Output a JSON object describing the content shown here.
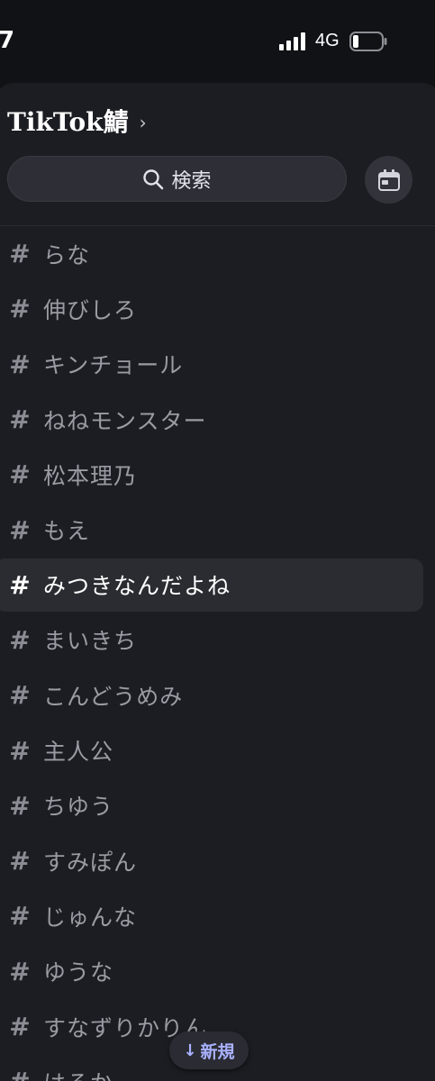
{
  "status_bar": {
    "time": "7",
    "network": "4G"
  },
  "server": {
    "title": "TikTok鯖",
    "chevron": "›"
  },
  "search": {
    "label": "検索",
    "icon": "search-icon"
  },
  "calendar_button": {
    "icon": "calendar-icon"
  },
  "channels": [
    {
      "hash": "#",
      "name": "らな"
    },
    {
      "hash": "#",
      "name": "伸びしろ"
    },
    {
      "hash": "#",
      "name": "キンチョール"
    },
    {
      "hash": "#",
      "name": "ねねモンスター"
    },
    {
      "hash": "#",
      "name": "松本理乃"
    },
    {
      "hash": "#",
      "name": "もえ"
    },
    {
      "hash": "#",
      "name": "みつきなんだよね",
      "active": true
    },
    {
      "hash": "#",
      "name": "まいきち"
    },
    {
      "hash": "#",
      "name": "こんどうめみ"
    },
    {
      "hash": "#",
      "name": "主人公"
    },
    {
      "hash": "#",
      "name": "ちゆう"
    },
    {
      "hash": "#",
      "name": "すみぽん"
    },
    {
      "hash": "#",
      "name": "じゅんな"
    },
    {
      "hash": "#",
      "name": "ゆうな"
    },
    {
      "hash": "#",
      "name": "すなずりかりん"
    },
    {
      "hash": "#",
      "name": "はるか"
    }
  ],
  "new_pill": {
    "arrow": "↓",
    "label": "新規"
  },
  "colors": {
    "background": "#111216",
    "panel": "#1c1d22",
    "active_row": "#2b2c32",
    "muted_text": "#9a9ba3",
    "accent": "#aab2ff"
  }
}
